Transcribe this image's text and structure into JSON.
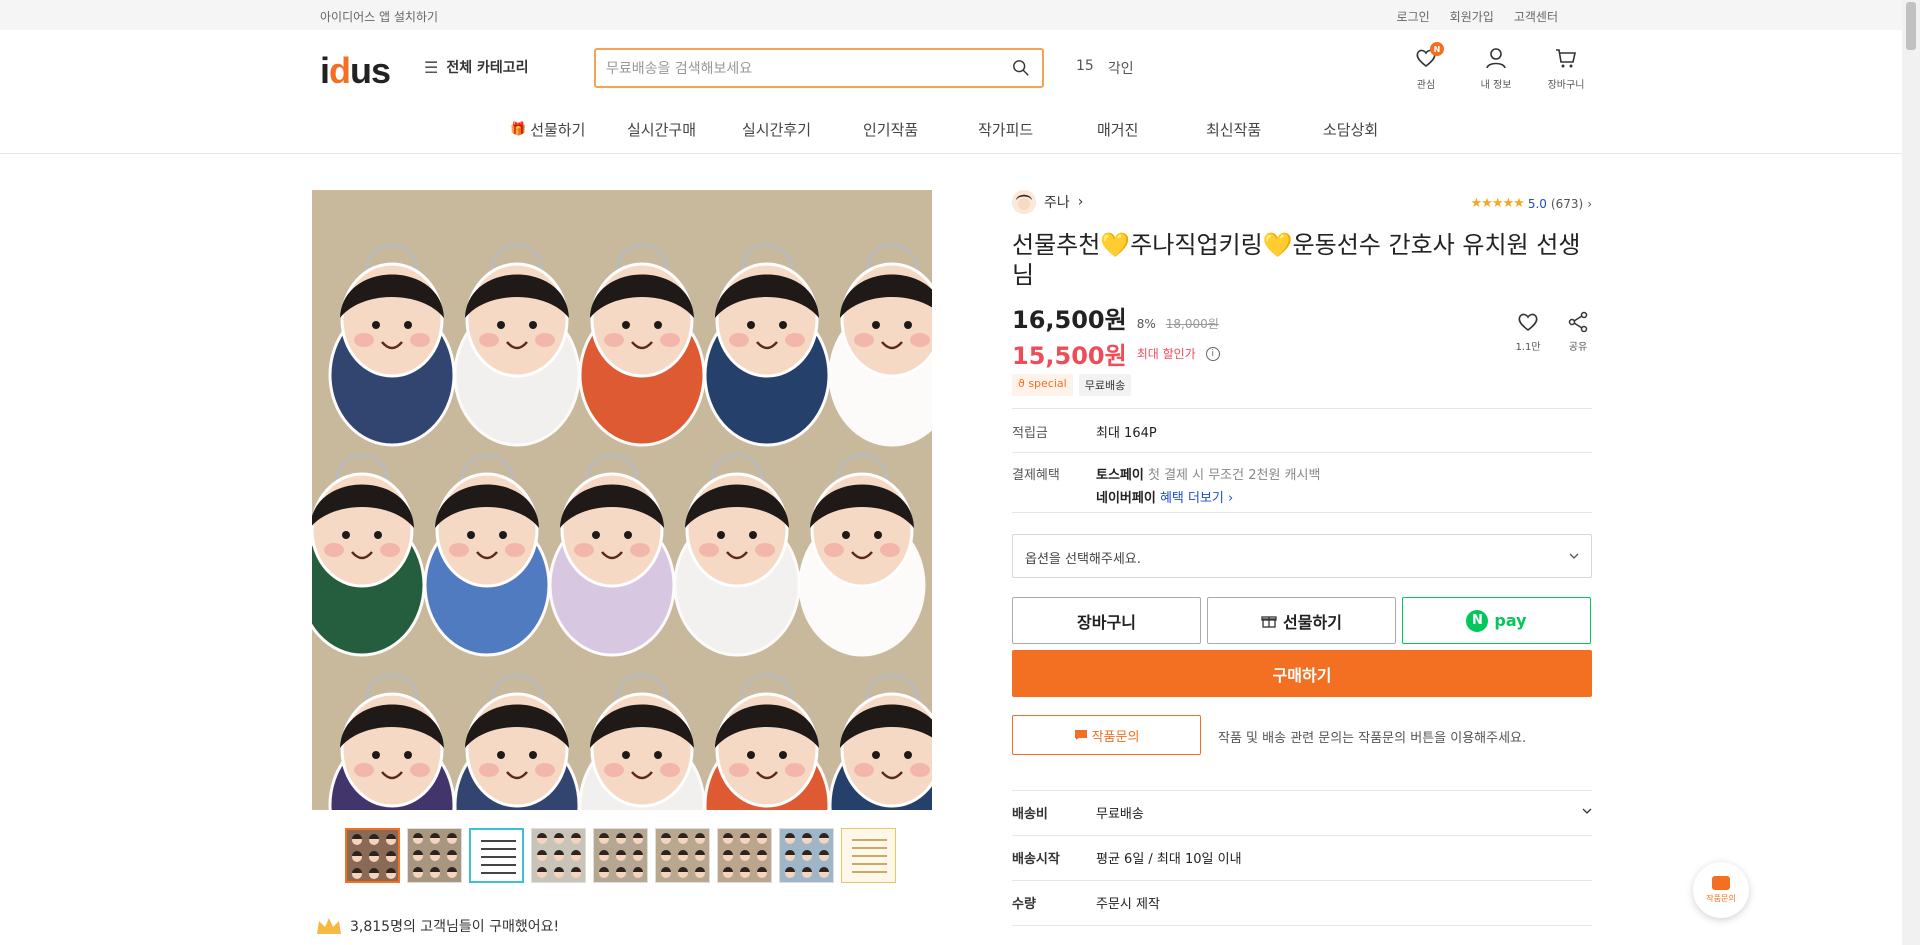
{
  "topbar": {
    "app_install": "아이디어스 앱 설치하기",
    "login": "로그인",
    "signup": "회원가입",
    "support": "고객센터"
  },
  "header": {
    "logo": "idus",
    "category": "전체 카테고리",
    "search_placeholder": "무료배송을 검색해보세요",
    "rank_number": "15",
    "rank_keyword": "각인",
    "icons": [
      {
        "label": "관심",
        "badge": "N"
      },
      {
        "label": "내 정보"
      },
      {
        "label": "장바구니"
      }
    ]
  },
  "nav": [
    "선물하기",
    "실시간구매",
    "실시간후기",
    "인기작품",
    "작가피드",
    "매거진",
    "최신작품",
    "소담상회"
  ],
  "gallery": {
    "thumbnail_count": 9,
    "buyers_text": "3,815명의 고객님들이 구매했어요!"
  },
  "product": {
    "artist": "주나",
    "rating_score": "5.0",
    "rating_count": "(673)",
    "title": "선물추천💛주나직업키링💛운동선수 간호사 유치원 선생님",
    "price": "16,500원",
    "discount": "8%",
    "original_price": "18,000원",
    "max_price": "15,500원",
    "max_label": "최대 할인가",
    "tags": [
      "special",
      "무료배송"
    ],
    "like_count": "1.1만",
    "share_label": "공유",
    "points_label": "적립금",
    "points_value": "최대 164P",
    "benefit_label": "결제혜택",
    "toss": "토스페이",
    "toss_desc": "첫 결제 시 무조건 2천원 캐시백",
    "naver": "네이버페이",
    "naver_link": "혜택 더보기",
    "option_placeholder": "옵션을 선택해주세요.",
    "cart_button": "장바구니",
    "gift_button": "선물하기",
    "npay_label": "pay",
    "buy_button": "구매하기",
    "inquiry_button": "작품문의",
    "inquiry_note": "작품 및 배송 관련 문의는 작품문의 버튼을 이용해주세요.",
    "shipping_label": "배송비",
    "shipping_value": "무료배송",
    "ship_start_label": "배송시작",
    "ship_start_value": "평균 6일 / 최대 10일 이내",
    "quantity_label": "수량",
    "quantity_value": "주문시 제작"
  },
  "fab_label": "작품문의",
  "colors": {
    "brand": "#f36f21",
    "sale": "#ef4c59",
    "npay": "#03c75a",
    "link": "#1f4ec9"
  }
}
